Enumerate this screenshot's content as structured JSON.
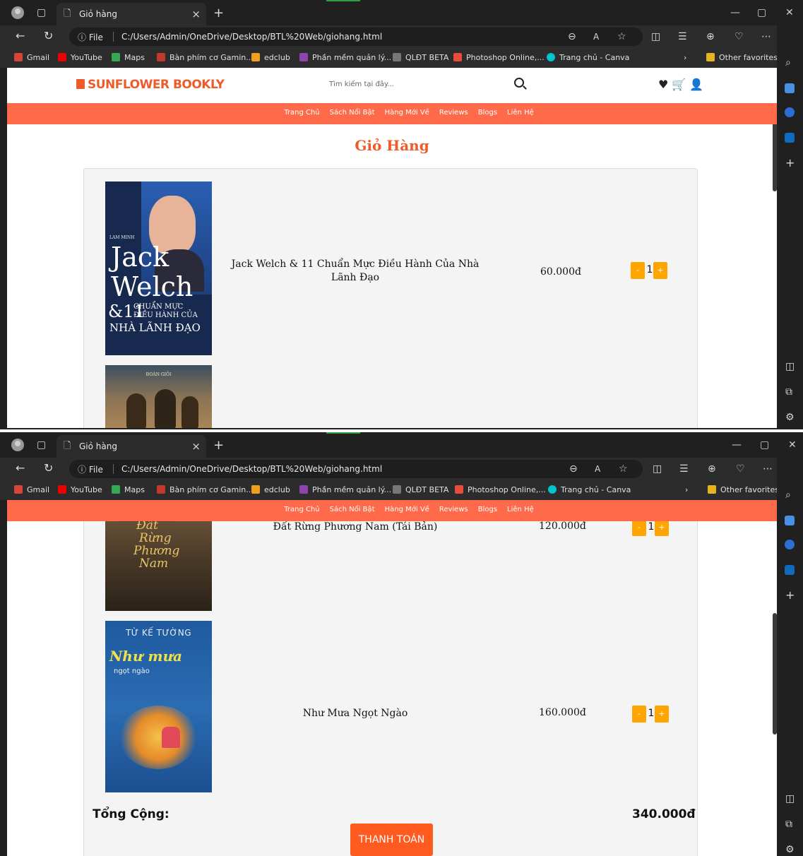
{
  "browser": {
    "tab_title": "Giỏ hàng",
    "info_label": "ⓘ File",
    "url": "C:/Users/Admin/OneDrive/Desktop/BTL%20Web/giohang.html",
    "favorites": [
      "Gmail",
      "YouTube",
      "Maps",
      "Bàn phím cơ Gamin...",
      "edclub",
      "Phần mềm quản lý...",
      "QLĐT BETA",
      "Photoshop Online,...",
      "Trang chủ - Canva"
    ],
    "other_favorites": "Other favorites"
  },
  "site": {
    "logo": "SUNFLOWER BOOKLY",
    "search_placeholder": "Tìm kiếm tại đây...",
    "nav": [
      "Trang Chủ",
      "Sách Nổi Bật",
      "Hàng Mới Về",
      "Reviews",
      "Blogs",
      "Liên Hệ"
    ],
    "page_title": "Giỏ Hàng"
  },
  "cart": {
    "items": [
      {
        "name": "Jack Welch & 11 Chuẩn Mực Điều Hành Của Nhà Lãnh Đạo",
        "price": "60.000đ",
        "qty": "1",
        "cover": {
          "author": "LAM MINH",
          "t1": "Jack",
          "t2": "Welch",
          "t3": "&11",
          "t4": "CHUẨN MỰC",
          "t5": "ĐIỀU HÀNH CỦA",
          "t6": "NHÀ LÃNH ĐẠO"
        }
      },
      {
        "name": "Đất Rừng Phương Nam (Tái Bản)",
        "price": "120.000đ",
        "qty": "1",
        "cover": {
          "author": "ĐOÀN GIỎI",
          "t1": "Đất",
          "t2": "Rừng",
          "t3": "Phương",
          "t4": "Nam"
        }
      },
      {
        "name": "Như Mưa Ngọt Ngào",
        "price": "160.000đ",
        "qty": "1",
        "cover": {
          "author": "TỪ KẾ TƯỜNG",
          "t1": "Như mưa",
          "t2": "ngọt ngào"
        }
      }
    ],
    "minus": "-",
    "plus": "+",
    "total_label": "Tổng Cộng:",
    "total_value": "340.000đ",
    "checkout": "THANH TOÁN"
  },
  "colors": {
    "accent": "#ef5a2a",
    "nav_bg": "#ff6a4a",
    "qty_button": "#ffa500",
    "checkout_bg": "#ff5a1f"
  }
}
